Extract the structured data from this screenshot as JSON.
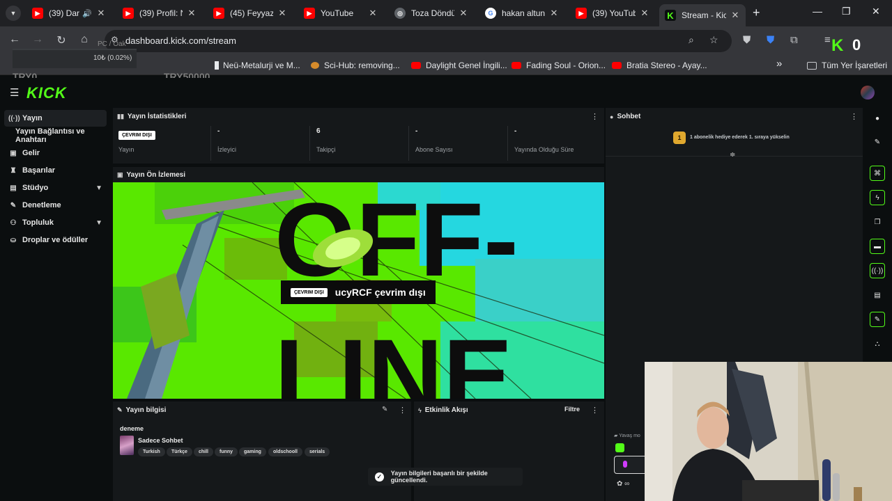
{
  "browser": {
    "tabs": [
      {
        "title": "(39) Dar",
        "favicon": "youtube",
        "has_audio": true
      },
      {
        "title": "(39) Profil: N",
        "favicon": "youtube"
      },
      {
        "title": "(45) Feyyaz Y",
        "favicon": "youtube"
      },
      {
        "title": "YouTube",
        "favicon": "youtube"
      },
      {
        "title": "Toza Döndü",
        "favicon": "globe"
      },
      {
        "title": "hakan altun",
        "favicon": "google"
      },
      {
        "title": "(39) YouTub",
        "favicon": "youtube"
      },
      {
        "title": "Stream - Kic",
        "favicon": "kick",
        "active": true
      }
    ],
    "new_tab": "+",
    "url": "dashboard.kick.com/stream",
    "bookmarks": [
      {
        "title": "Neü-Metalurji ve M..."
      },
      {
        "title": "Sci-Hub: removing..."
      },
      {
        "title": "Daylight Genel İngili..."
      },
      {
        "title": "Fading Soul - Orion..."
      },
      {
        "title": "Bratia Stereo - Ayay..."
      }
    ],
    "bookmarks_overflow": "»",
    "all_bookmarks": "Tüm Yer İşaretleri"
  },
  "overlay": {
    "small_label": "PC / Oak",
    "rate": "10₺ (0.02%)",
    "left_amount": "TRY0",
    "right_amount": "TRY50000",
    "counter_letter": "K",
    "counter_value": "0"
  },
  "kick": {
    "logo": "KICK",
    "sidebar": [
      {
        "label": "Yayın",
        "icon": "broadcast-icon",
        "active": true
      },
      {
        "label": "Yayın Bağlantısı ve Anahtarı",
        "sub": true
      },
      {
        "label": "Gelir",
        "icon": "wallet-icon"
      },
      {
        "label": "Başarılar",
        "icon": "trophy-icon"
      },
      {
        "label": "Stüdyo",
        "icon": "studio-icon",
        "expandable": true
      },
      {
        "label": "Denetleme",
        "icon": "wrench-icon"
      },
      {
        "label": "Topluluk",
        "icon": "community-icon",
        "expandable": true
      },
      {
        "label": "Droplar ve ödüller",
        "icon": "drops-icon"
      }
    ],
    "stats": {
      "title": "Yayın İstatistikleri",
      "items": [
        {
          "value": "ÇEVRIM DIŞI",
          "label": "Yayın"
        },
        {
          "value": "-",
          "label": "İzleyici"
        },
        {
          "value": "6",
          "label": "Takipçi"
        },
        {
          "value": "-",
          "label": "Abone Sayısı"
        },
        {
          "value": "-",
          "label": "Yayında Olduğu Süre"
        }
      ]
    },
    "preview": {
      "title": "Yayın Ön İzlemesi",
      "badge": "ÇEVRIM DIŞI",
      "text": "ucyRCF çevrim dışı",
      "art_text_top": "OFF-",
      "art_text_bottom": "LINE"
    },
    "info": {
      "title": "Yayın bilgisi",
      "stream_title": "deneme",
      "category": "Sadece Sohbet",
      "tags": [
        "Turkish",
        "Türkçe",
        "chill",
        "funny",
        "gaming",
        "oldschooll",
        "serials"
      ]
    },
    "activity": {
      "title": "Etkinlik Akışı",
      "filter": "Filtre"
    },
    "chat": {
      "title": "Sohbet",
      "rank_number": "1",
      "gift_text": "1 abonelik hediye ederek 1. sıraya yükselin",
      "slow_mode": "Yavaş mo"
    },
    "toast": "Yayın bilgileri başarılı bir şekilde güncellendi."
  },
  "colors": {
    "brand": "#53fc18",
    "panel": "#15181a",
    "background": "#0b0e0f"
  }
}
